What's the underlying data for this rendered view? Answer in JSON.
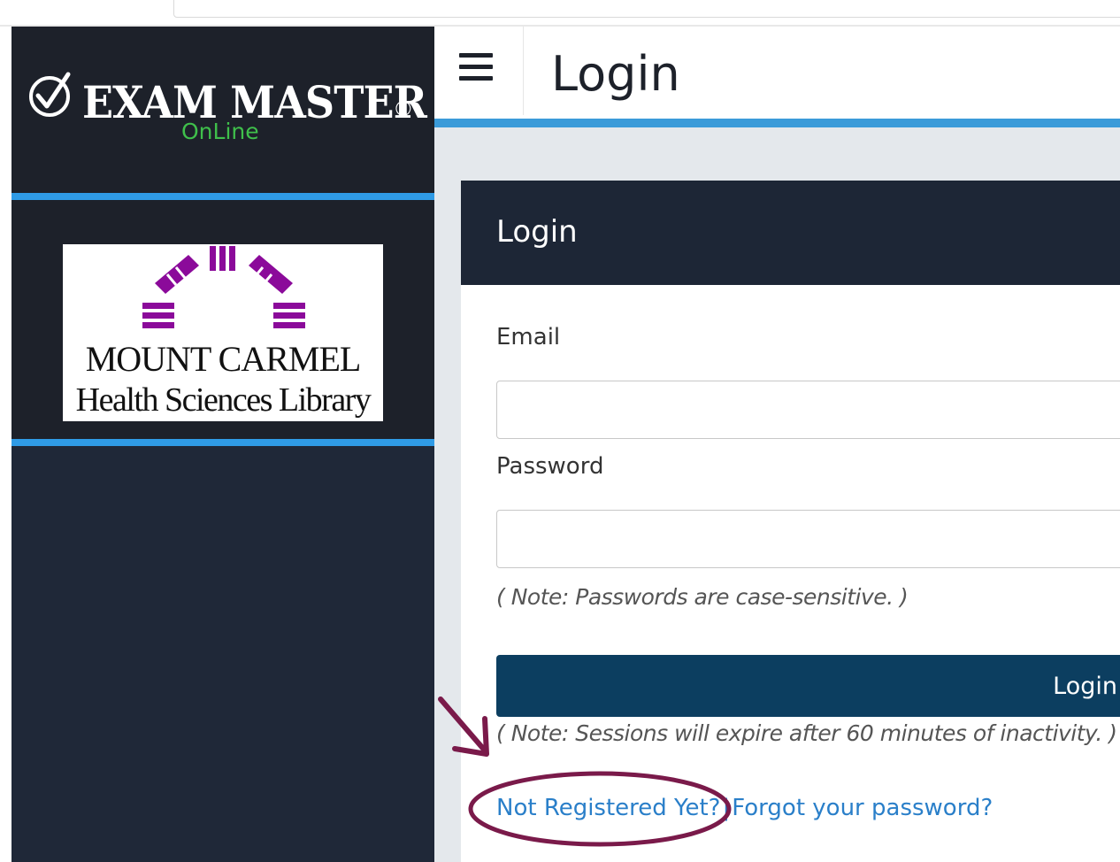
{
  "brand": {
    "name": "EXAM MASTER",
    "registered": "®",
    "subtitle": "OnLine",
    "check_icon": "check-circle-icon"
  },
  "institution": {
    "line1": "MOUNT CARMEL",
    "line2": "Health Sciences Library",
    "logo_icon": "arch-logo-icon"
  },
  "header": {
    "menu_icon": "hamburger-menu-icon",
    "title": "Login"
  },
  "login_card": {
    "title": "Login",
    "email_label": "Email",
    "email_value": "",
    "password_label": "Password",
    "password_value": "",
    "password_note": "( Note: Passwords are case-sensitive. )",
    "login_button": "Login",
    "session_note": "( Note: Sessions will expire after 60 minutes of inactivity. )",
    "register_link": "Not Registered Yet?",
    "separator": "|",
    "forgot_link": "Forgot your password?"
  },
  "colors": {
    "sidebar_bg": "#1f2838",
    "accent_blue": "#2f9be6",
    "button_bg": "#0c3e60",
    "link": "#2a7fc9",
    "brand_green": "#3fbf4b",
    "logo_purple": "#8b0a9a",
    "annotation": "#7a1a4a"
  }
}
